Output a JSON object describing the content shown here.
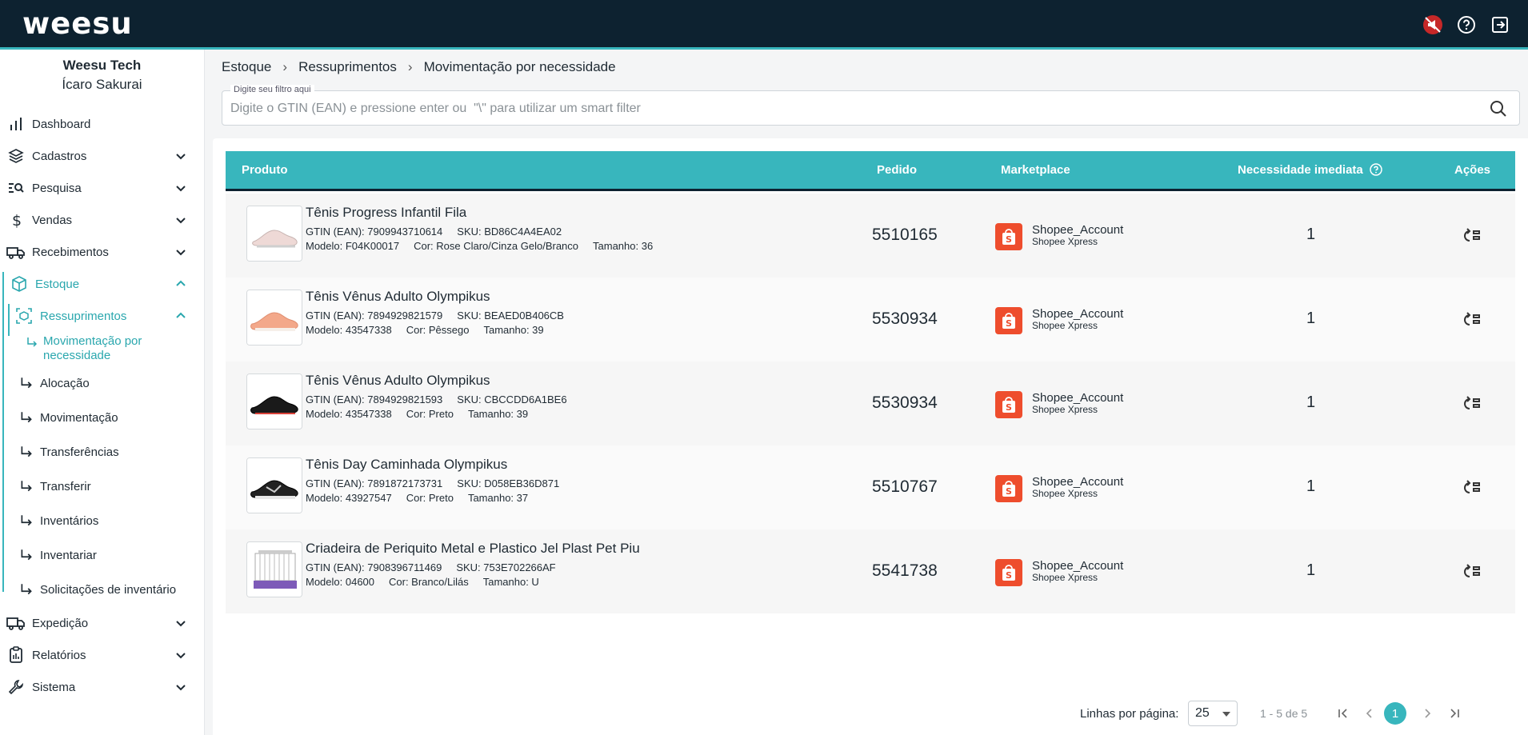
{
  "app": {
    "logo": "weesu"
  },
  "sidebar": {
    "company": "Weesu Tech",
    "user": "Ícaro Sakurai",
    "items": [
      {
        "label": "Dashboard"
      },
      {
        "label": "Cadastros"
      },
      {
        "label": "Pesquisa"
      },
      {
        "label": "Vendas"
      },
      {
        "label": "Recebimentos"
      },
      {
        "label": "Estoque"
      },
      {
        "label": "Ressuprimentos"
      },
      {
        "label": "Expedição"
      },
      {
        "label": "Relatórios"
      },
      {
        "label": "Sistema"
      }
    ],
    "active_sub": "Movimentação por necessidade",
    "subs": [
      "Alocação",
      "Movimentação",
      "Transferências",
      "Transferir",
      "Inventários",
      "Inventariar",
      "Solicitações de inventário"
    ]
  },
  "breadcrumb": [
    "Estoque",
    "Ressuprimentos",
    "Movimentação por necessidade"
  ],
  "filter": {
    "label": "Digite seu filtro aqui",
    "placeholder": "Digite o GTIN (EAN) e pressione enter ou  \"\\\" para utilizar um smart filter"
  },
  "table": {
    "headers": {
      "product": "Produto",
      "order": "Pedido",
      "marketplace": "Marketplace",
      "need": "Necessidade imediata",
      "actions": "Ações"
    },
    "rows": [
      {
        "name": "Tênis Progress Infantil Fila",
        "gtin": "GTIN (EAN): 7909943710614",
        "sku": "SKU: BD86C4A4EA02",
        "model": "Modelo: F04K00017",
        "color": "Cor: Rose Claro/Cinza Gelo/Branco",
        "size": "Tamanho: 36",
        "order": "5510165",
        "mk_name": "Shopee_Account",
        "mk_sub": "Shopee Xpress",
        "need": "1"
      },
      {
        "name": "Tênis Vênus Adulto Olympikus",
        "gtin": "GTIN (EAN): 7894929821579",
        "sku": "SKU: BEAED0B406CB",
        "model": "Modelo: 43547338",
        "color": "Cor: Pêssego",
        "size": "Tamanho: 39",
        "order": "5530934",
        "mk_name": "Shopee_Account",
        "mk_sub": "Shopee Xpress",
        "need": "1"
      },
      {
        "name": "Tênis Vênus Adulto Olympikus",
        "gtin": "GTIN (EAN): 7894929821593",
        "sku": "SKU: CBCCDD6A1BE6",
        "model": "Modelo: 43547338",
        "color": "Cor: Preto",
        "size": "Tamanho: 39",
        "order": "5530934",
        "mk_name": "Shopee_Account",
        "mk_sub": "Shopee Xpress",
        "need": "1"
      },
      {
        "name": "Tênis Day Caminhada Olympikus",
        "gtin": "GTIN (EAN): 7891872173731",
        "sku": "SKU: D058EB36D871",
        "model": "Modelo: 43927547",
        "color": "Cor: Preto",
        "size": "Tamanho: 37",
        "order": "5510767",
        "mk_name": "Shopee_Account",
        "mk_sub": "Shopee Xpress",
        "need": "1"
      },
      {
        "name": "Criadeira de Periquito Metal e Plastico Jel Plast Pet Piu",
        "gtin": "GTIN (EAN): 7908396711469",
        "sku": "SKU: 753E702266AF",
        "model": "Modelo: 04600",
        "color": "Cor: Branco/Lilás",
        "size": "Tamanho: U",
        "order": "5541738",
        "mk_name": "Shopee_Account",
        "mk_sub": "Shopee Xpress",
        "need": "1"
      }
    ]
  },
  "pagination": {
    "label": "Linhas por página:",
    "per_page": "25",
    "range": "1 - 5 de 5",
    "current": "1"
  },
  "colors": {
    "brand_dark": "#0d2230",
    "accent": "#38b6bd",
    "shopee": "#ee4d2d"
  }
}
